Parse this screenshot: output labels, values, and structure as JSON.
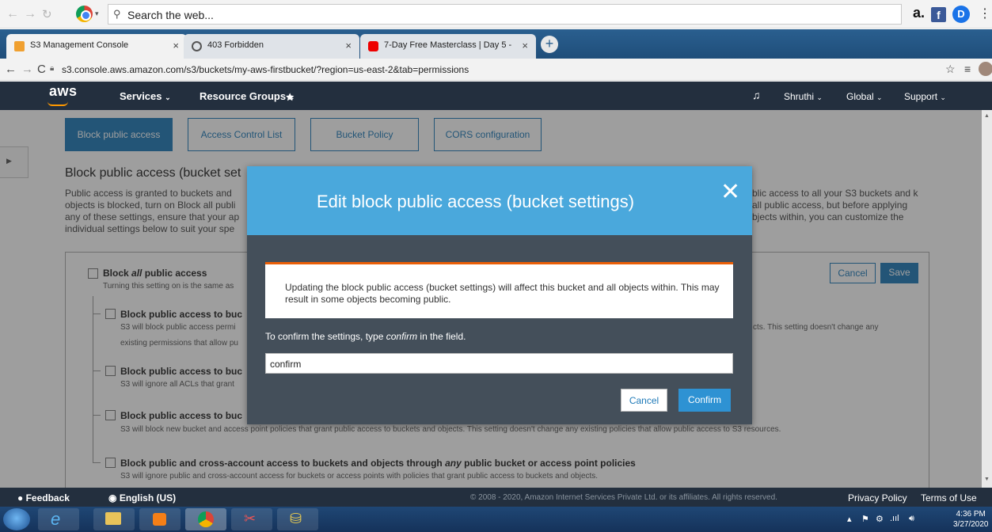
{
  "browser": {
    "search_placeholder": "Search the web...",
    "tabs": [
      {
        "label": "S3 Management Console"
      },
      {
        "label": "403 Forbidden"
      },
      {
        "label": "7-Day Free Masterclass | Day 5 -"
      }
    ],
    "url": "s3.console.aws.amazon.com/s3/buckets/my-aws-firstbucket/?region=us-east-2&tab=permissions"
  },
  "aws_nav": {
    "logo": "aws",
    "services": "Services",
    "resource_groups": "Resource Groups",
    "user": "Shruthi",
    "region": "Global",
    "support": "Support"
  },
  "page": {
    "tabs": [
      "Block public access",
      "Access Control List",
      "Bucket Policy",
      "CORS configuration"
    ],
    "heading": "Block public access (bucket set",
    "desc_left": "Public access is granted to buckets and objects is blocked, turn on Block all publi any of these settings, ensure that your ap individual settings below to suit your spe",
    "desc_right": "blic access to all your S3 buckets and k all public access, but before applying bjects within, you can customize the",
    "block_all": {
      "label_pre": "Block ",
      "label_em": "all",
      "label_post": " public access",
      "desc": "Turning this setting on is the same as"
    },
    "options": [
      {
        "label": "Block public access to buc",
        "desc": "S3 will block public access permi",
        "desc2": "existing permissions that allow pu",
        "desc_right": "cts. This setting doesn't change any"
      },
      {
        "label": "Block public access to buc",
        "desc": "S3 will ignore all ACLs that grant"
      },
      {
        "label": "Block public access to buc",
        "desc": "S3 will block new bucket and access point policies that grant public access to buckets and objects. This setting doesn't change any existing policies that allow public access to S3 resources."
      },
      {
        "label_pre": "Block public and cross-account access to buckets and objects through ",
        "label_em": "any",
        "label_post": " public bucket or access point policies",
        "desc": "S3 will ignore public and cross-account access for buckets or access points with policies that grant public access to buckets and objects."
      }
    ],
    "cancel": "Cancel",
    "save": "Save"
  },
  "modal": {
    "title": "Edit block public access (bucket settings)",
    "alert": "Updating the block public access (bucket settings) will affect this bucket and all objects within. This may result in some objects becoming public.",
    "confirm_pre": "To confirm the settings, type ",
    "confirm_em": "confirm",
    "confirm_post": " in the field.",
    "input_value": "confirm",
    "cancel": "Cancel",
    "confirm_button": "Confirm"
  },
  "footer": {
    "feedback": "Feedback",
    "language": "English (US)",
    "copyright": "© 2008 - 2020, Amazon Internet Services Private Ltd. or its affiliates. All rights reserved.",
    "privacy": "Privacy Policy",
    "terms": "Terms of Use"
  },
  "taskbar": {
    "time": "4:36 PM",
    "date": "3/27/2020"
  },
  "colors": {
    "aws_nav": "#232f3e",
    "aws_blue": "#1f7ab8",
    "modal_header": "#4aa8dc",
    "alert_accent": "#eb5f07"
  }
}
